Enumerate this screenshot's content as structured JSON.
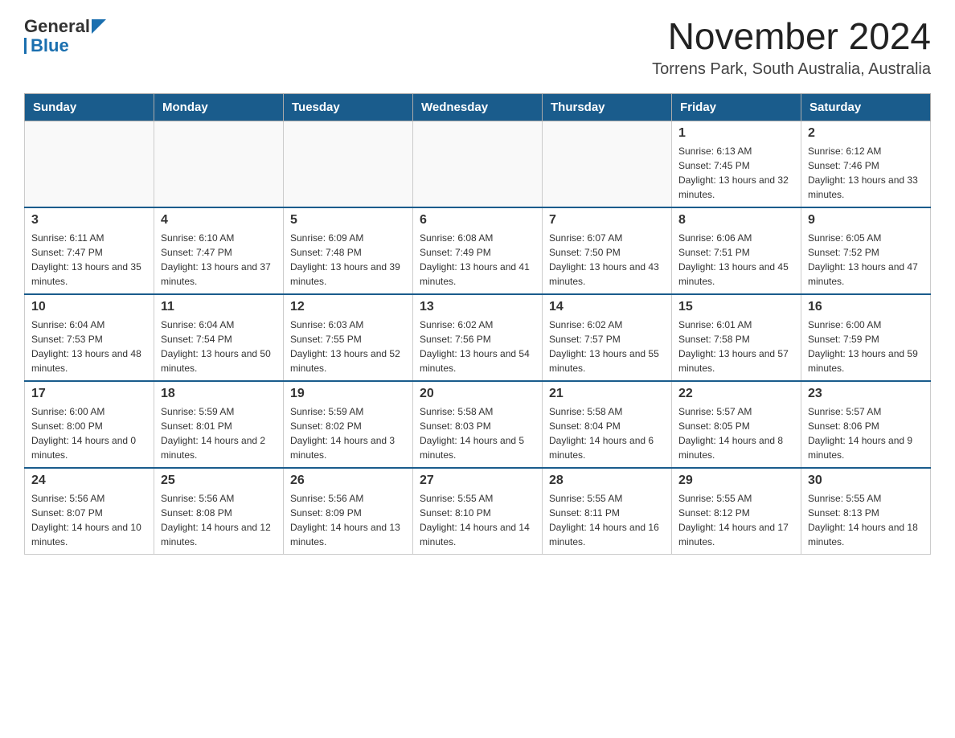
{
  "header": {
    "logo_general": "General",
    "logo_blue": "Blue",
    "title": "November 2024",
    "subtitle": "Torrens Park, South Australia, Australia"
  },
  "calendar": {
    "days_of_week": [
      "Sunday",
      "Monday",
      "Tuesday",
      "Wednesday",
      "Thursday",
      "Friday",
      "Saturday"
    ],
    "weeks": [
      [
        {
          "day": "",
          "info": ""
        },
        {
          "day": "",
          "info": ""
        },
        {
          "day": "",
          "info": ""
        },
        {
          "day": "",
          "info": ""
        },
        {
          "day": "",
          "info": ""
        },
        {
          "day": "1",
          "info": "Sunrise: 6:13 AM\nSunset: 7:45 PM\nDaylight: 13 hours and 32 minutes."
        },
        {
          "day": "2",
          "info": "Sunrise: 6:12 AM\nSunset: 7:46 PM\nDaylight: 13 hours and 33 minutes."
        }
      ],
      [
        {
          "day": "3",
          "info": "Sunrise: 6:11 AM\nSunset: 7:47 PM\nDaylight: 13 hours and 35 minutes."
        },
        {
          "day": "4",
          "info": "Sunrise: 6:10 AM\nSunset: 7:47 PM\nDaylight: 13 hours and 37 minutes."
        },
        {
          "day": "5",
          "info": "Sunrise: 6:09 AM\nSunset: 7:48 PM\nDaylight: 13 hours and 39 minutes."
        },
        {
          "day": "6",
          "info": "Sunrise: 6:08 AM\nSunset: 7:49 PM\nDaylight: 13 hours and 41 minutes."
        },
        {
          "day": "7",
          "info": "Sunrise: 6:07 AM\nSunset: 7:50 PM\nDaylight: 13 hours and 43 minutes."
        },
        {
          "day": "8",
          "info": "Sunrise: 6:06 AM\nSunset: 7:51 PM\nDaylight: 13 hours and 45 minutes."
        },
        {
          "day": "9",
          "info": "Sunrise: 6:05 AM\nSunset: 7:52 PM\nDaylight: 13 hours and 47 minutes."
        }
      ],
      [
        {
          "day": "10",
          "info": "Sunrise: 6:04 AM\nSunset: 7:53 PM\nDaylight: 13 hours and 48 minutes."
        },
        {
          "day": "11",
          "info": "Sunrise: 6:04 AM\nSunset: 7:54 PM\nDaylight: 13 hours and 50 minutes."
        },
        {
          "day": "12",
          "info": "Sunrise: 6:03 AM\nSunset: 7:55 PM\nDaylight: 13 hours and 52 minutes."
        },
        {
          "day": "13",
          "info": "Sunrise: 6:02 AM\nSunset: 7:56 PM\nDaylight: 13 hours and 54 minutes."
        },
        {
          "day": "14",
          "info": "Sunrise: 6:02 AM\nSunset: 7:57 PM\nDaylight: 13 hours and 55 minutes."
        },
        {
          "day": "15",
          "info": "Sunrise: 6:01 AM\nSunset: 7:58 PM\nDaylight: 13 hours and 57 minutes."
        },
        {
          "day": "16",
          "info": "Sunrise: 6:00 AM\nSunset: 7:59 PM\nDaylight: 13 hours and 59 minutes."
        }
      ],
      [
        {
          "day": "17",
          "info": "Sunrise: 6:00 AM\nSunset: 8:00 PM\nDaylight: 14 hours and 0 minutes."
        },
        {
          "day": "18",
          "info": "Sunrise: 5:59 AM\nSunset: 8:01 PM\nDaylight: 14 hours and 2 minutes."
        },
        {
          "day": "19",
          "info": "Sunrise: 5:59 AM\nSunset: 8:02 PM\nDaylight: 14 hours and 3 minutes."
        },
        {
          "day": "20",
          "info": "Sunrise: 5:58 AM\nSunset: 8:03 PM\nDaylight: 14 hours and 5 minutes."
        },
        {
          "day": "21",
          "info": "Sunrise: 5:58 AM\nSunset: 8:04 PM\nDaylight: 14 hours and 6 minutes."
        },
        {
          "day": "22",
          "info": "Sunrise: 5:57 AM\nSunset: 8:05 PM\nDaylight: 14 hours and 8 minutes."
        },
        {
          "day": "23",
          "info": "Sunrise: 5:57 AM\nSunset: 8:06 PM\nDaylight: 14 hours and 9 minutes."
        }
      ],
      [
        {
          "day": "24",
          "info": "Sunrise: 5:56 AM\nSunset: 8:07 PM\nDaylight: 14 hours and 10 minutes."
        },
        {
          "day": "25",
          "info": "Sunrise: 5:56 AM\nSunset: 8:08 PM\nDaylight: 14 hours and 12 minutes."
        },
        {
          "day": "26",
          "info": "Sunrise: 5:56 AM\nSunset: 8:09 PM\nDaylight: 14 hours and 13 minutes."
        },
        {
          "day": "27",
          "info": "Sunrise: 5:55 AM\nSunset: 8:10 PM\nDaylight: 14 hours and 14 minutes."
        },
        {
          "day": "28",
          "info": "Sunrise: 5:55 AM\nSunset: 8:11 PM\nDaylight: 14 hours and 16 minutes."
        },
        {
          "day": "29",
          "info": "Sunrise: 5:55 AM\nSunset: 8:12 PM\nDaylight: 14 hours and 17 minutes."
        },
        {
          "day": "30",
          "info": "Sunrise: 5:55 AM\nSunset: 8:13 PM\nDaylight: 14 hours and 18 minutes."
        }
      ]
    ]
  }
}
